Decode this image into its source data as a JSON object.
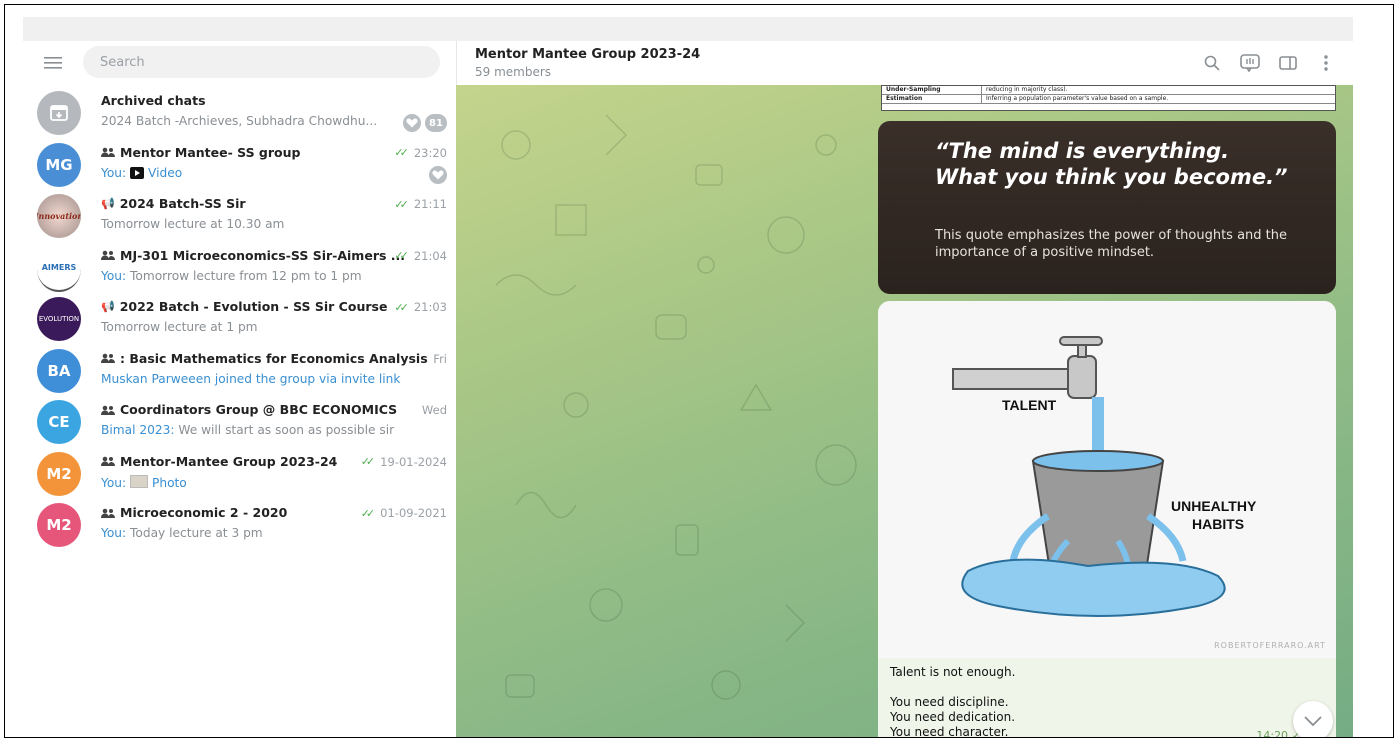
{
  "sidebar": {
    "search_placeholder": "Search",
    "chats": [
      {
        "title": "Archived chats",
        "subtitle": "2024 Batch -Archieves, Subhadra Chowdhu...",
        "badge": "81",
        "avatar_color": "#b5b9bd",
        "avatar_icon": "archive-icon"
      },
      {
        "title": "Mentor Mantee- SS group",
        "time": "23:20",
        "sender": "You: ",
        "subtitle": "Video",
        "avatar_text": "MG",
        "avatar_color": "#4a8fd6",
        "type": "group"
      },
      {
        "title": "2024 Batch-SS Sir",
        "time": "21:11",
        "subtitle": "Tomorrow lecture at 10.30 am",
        "avatar_color": "#ddd",
        "type": "channel"
      },
      {
        "title": "MJ-301 Microeconomics-SS Sir-Aimers ...",
        "time": "21:04",
        "sender": "You: ",
        "subtitle": "Tomorrow lecture from 12 pm to 1 pm",
        "avatar_text": "AIMERS",
        "avatar_color": "#fff",
        "type": "group"
      },
      {
        "title": "2022 Batch - Evolution - SS Sir Course",
        "time": "21:03",
        "subtitle": "Tomorrow lecture at 1 pm",
        "avatar_text": "EVOLUTION",
        "avatar_color": "#3b1a5c",
        "type": "channel"
      },
      {
        "title": ": Basic Mathematics for Economics Analysis",
        "time": "Fri",
        "subtitle": "Muskan Parweeen joined the group via invite link",
        "avatar_text": "BA",
        "avatar_color": "#3f8ed8",
        "type": "group"
      },
      {
        "title": "Coordinators Group @ BBC ECONOMICS",
        "time": "Wed",
        "sender": "Bimal 2023: ",
        "subtitle": "We will start as soon as possible sir",
        "avatar_text": "CE",
        "avatar_color": "#3aa5e0",
        "type": "group"
      },
      {
        "title": "Mentor-Mantee Group 2023-24",
        "time": "19-01-2024",
        "sender": "You: ",
        "subtitle": "Photo",
        "avatar_text": "M2",
        "avatar_color": "#f3943a",
        "type": "group"
      },
      {
        "title": "Microeconomic 2 - 2020",
        "time": "01-09-2021",
        "sender": "You: ",
        "subtitle": "Today lecture at 3 pm",
        "avatar_text": "M2",
        "avatar_color": "#e5567a",
        "type": "group"
      }
    ]
  },
  "chat": {
    "title": "Mentor Mantee Group 2023-24",
    "subtitle": "59 members",
    "table_rows": [
      {
        "term": "Under-Sampling",
        "desc": "reducing in majority class)."
      },
      {
        "term": "Estimation",
        "desc": "Inferring a population parameter's value based on a sample."
      }
    ],
    "quote": "“The mind is everything. What you think you become.”",
    "quote_desc": "This quote emphasizes the power of thoughts and the importance of a positive mindset.",
    "image_labels": {
      "talent": "TALENT",
      "habits_1": "UNHEALTHY",
      "habits_2": "HABITS",
      "credit": "ROBERTOFERRARO.ART"
    },
    "caption_lines": [
      "Talent is not enough.",
      "",
      "You need discipline.",
      "You need dedication.",
      "You need character."
    ],
    "message_time": "14:20"
  }
}
